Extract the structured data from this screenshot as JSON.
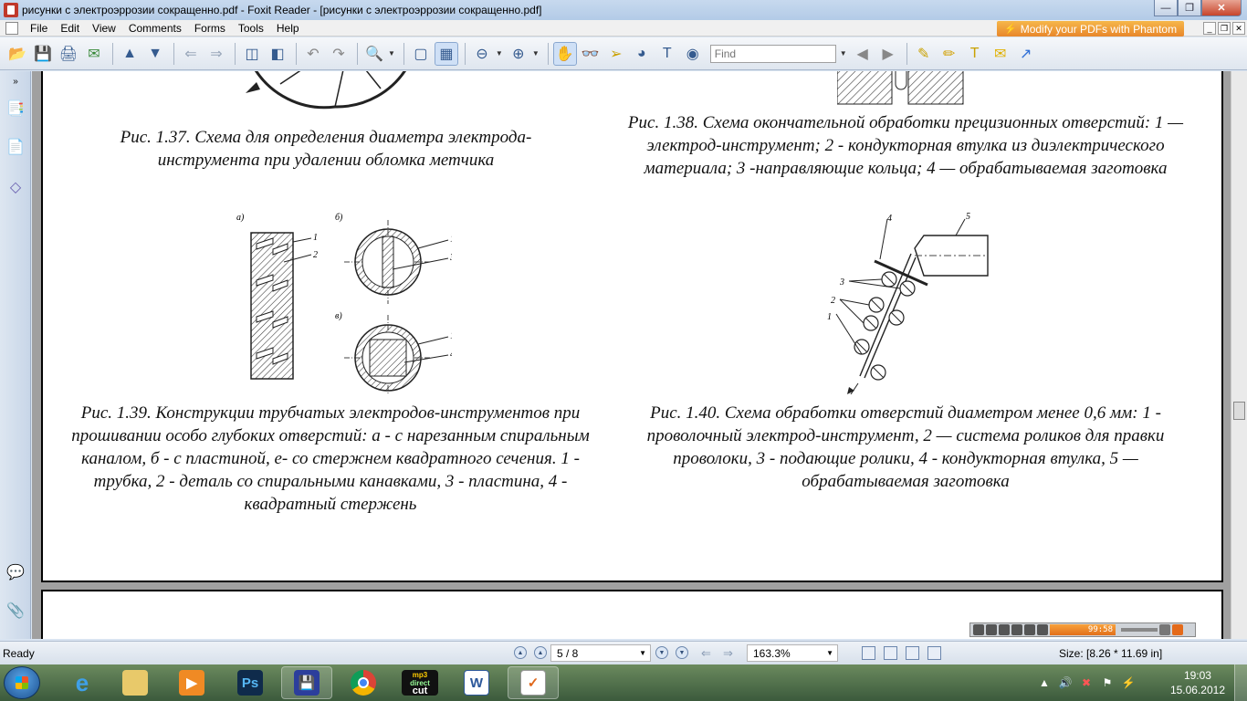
{
  "window": {
    "title": "рисунки с электроэррозии сокращенно.pdf - Foxit Reader - [рисунки с электроэррозии сокращенно.pdf]"
  },
  "menu": [
    "File",
    "Edit",
    "View",
    "Comments",
    "Forms",
    "Tools",
    "Help"
  ],
  "promo": "Modify your PDFs with Phantom",
  "toolbar": {
    "find_placeholder": "Find"
  },
  "captions": {
    "fig137": "Рис. 1.37. Схема для определения диаметра электрода-инструмента при удалении обломка метчика",
    "fig138": "Рис. 1.38. Схема окончательной обработки прецизионных отверстий: 1 —электрод-инструмент; 2 - кондукторная втулка из диэлектрического материала; 3 -направляющие кольца; 4 — обрабатываемая заготовка",
    "fig139": "Рис. 1.39. Конструкции трубчатых электродов-инструментов при прошивании особо глубоких отверстий: а - с нарезанным спиральным каналом, б - с пластиной, е- со стержнем квадратного сечения. 1 - трубка, 2 - деталь со спиральными канавками, 3 - пластина, 4 - квадратный стержень",
    "fig140": "Рис. 1.40. Схема обработки отверстий диаметром менее 0,6 мм: 1 - проволочный электрод-инструмент, 2 — система роликов для правки проволоки, 3 - подающие ролики, 4 - кондукторная втулка, 5 — обрабатываемая заготовка"
  },
  "figure_labels": {
    "f139": {
      "a": "а)",
      "b": "б)",
      "v": "в)",
      "n1": "1",
      "n2": "2",
      "n3": "3",
      "n4": "4"
    },
    "f140": {
      "n1": "1",
      "n2": "2",
      "n3": "3",
      "n4": "4",
      "n5": "5"
    }
  },
  "media_player": {
    "time": "99:58"
  },
  "status": {
    "ready": "Ready",
    "page": "5 / 8",
    "zoom": "163.3%",
    "size": "Size: [8.26 * 11.69 in]"
  },
  "clock": {
    "time": "19:03",
    "date": "15.06.2012"
  },
  "taskbar_apps": [
    "Internet Explorer",
    "Windows Explorer",
    "Media Player",
    "Photoshop",
    "Save",
    "Chrome",
    "mp3 direct cut",
    "Word",
    "Foxit Reader"
  ],
  "taskbar_text": {
    "mp3": "mp3",
    "direct": "direct",
    "cut": "cut",
    "ps": "Ps"
  }
}
